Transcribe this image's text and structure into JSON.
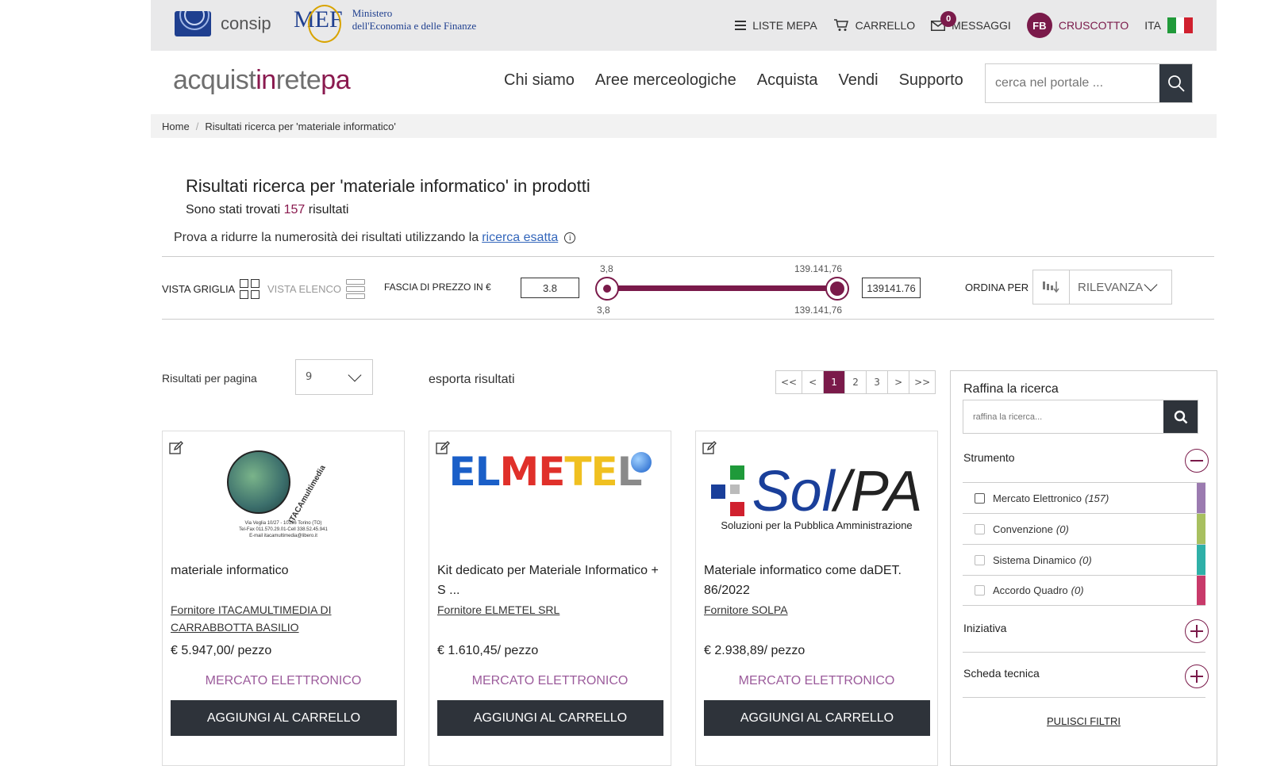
{
  "topbar": {
    "consip": "consip",
    "mef_mark": "MEF",
    "mef_line1": "Ministero",
    "mef_line2": "dell'Economia e delle Finanze",
    "liste": "LISTE MEPA",
    "carrello": "CARRELLO",
    "messaggi": "MESSAGGI",
    "messaggi_count": "0",
    "avatar": "FB",
    "cruscotto": "CRUSCOTTO",
    "lang": "ITA",
    "flag_colors": [
      "#219a3a",
      "#ffffff",
      "#d0202e"
    ]
  },
  "header": {
    "brand_a": "acquist",
    "brand_b": "in",
    "brand_c": "rete",
    "brand_d": "pa",
    "nav": [
      "Chi siamo",
      "Aree merceologiche",
      "Acquista",
      "Vendi",
      "Supporto"
    ],
    "search_placeholder": "cerca nel portale ..."
  },
  "breadcrumb": {
    "home": "Home",
    "sep": "/",
    "current": "Risultati ricerca per 'materiale informatico'"
  },
  "results": {
    "title": "Risultati ricerca per 'materiale informatico' in prodotti",
    "count_prefix": "Sono stati trovati",
    "count": "157",
    "count_suffix": "risultati",
    "hint": "Prova a ridurre la numerosità dei risultati utilizzando la",
    "hint_link": "ricerca esatta",
    "info": "i"
  },
  "filters": {
    "vista_griglia": "VISTA GRIGLIA",
    "vista_elenco": "VISTA ELENCO",
    "fascia_label": "FASCIA DI PREZZO IN €",
    "price_min": "3.8",
    "price_max": "139141.76",
    "slider_min_top": "3,8",
    "slider_max_top": "139.141,76",
    "slider_min_bottom": "3,8",
    "slider_max_bottom": "139.141,76",
    "ordina_label": "ORDINA PER",
    "ordina_value": "RILEVANZA"
  },
  "listing": {
    "rpp_label": "Risultati per pagina",
    "rpp_value": "9",
    "export": "esporta risultati",
    "pager": [
      "<<",
      "<",
      "1",
      "2",
      "3",
      ">",
      ">>"
    ],
    "active_page": "1"
  },
  "cards": [
    {
      "title": "materiale informatico",
      "supplier": "Fornitore ITACAMULTIMEDIA DI CARRABBOTTA BASILIO",
      "price": "€ 5.947,00/ pezzo",
      "market": "MERCATO ELETTRONICO",
      "button": "AGGIUNGI AL CARRELLO",
      "logo_name": "ITACAmultimedia",
      "logo_line1": "Via Veglia 10/27 - 10136 Torino (TO)",
      "logo_line2": "Tel-Fax 011.570.29.01-Cell 338.52.45.941",
      "logo_line3": "E-mail itacamultimedia@libero.it"
    },
    {
      "title": "Kit dedicato per Materiale Informatico + S ...",
      "supplier": "Fornitore ELMETEL SRL",
      "price": "€ 1.610,45/ pezzo",
      "market": "MERCATO ELETTRONICO",
      "button": "AGGIUNGI AL CARRELLO",
      "logo_letters": [
        "E",
        "L",
        "M",
        "E",
        "T",
        "E",
        "L"
      ],
      "logo_colors": [
        "#1a5fc8",
        "#1a5fc8",
        "#e0302a",
        "#e0302a",
        "#f0c020",
        "#f0c020",
        "#8a8a8a"
      ]
    },
    {
      "title": "Materiale informatico come daDET. 86/2022",
      "supplier": "Fornitore SOLPA",
      "price": "€ 2.938,89/ pezzo",
      "market": "MERCATO ELETTRONICO",
      "button": "AGGIUNGI AL CARRELLO",
      "logo_a": "Sol",
      "logo_b": "PA",
      "logo_sub": "Soluzioni per la Pubblica Amministrazione"
    }
  ],
  "sidebar": {
    "heading": "Raffina la ricerca",
    "search_placeholder": "raffina la ricerca...",
    "strumento": "Strumento",
    "facets": [
      {
        "label": "Mercato Elettronico",
        "count": "(157)",
        "color": "#9b7bb0"
      },
      {
        "label": "Convenzione",
        "count": "(0)",
        "color": "#a8c060"
      },
      {
        "label": "Sistema Dinamico",
        "count": "(0)",
        "color": "#2fb0a8"
      },
      {
        "label": "Accordo Quadro",
        "count": "(0)",
        "color": "#c83a6a"
      }
    ],
    "iniziativa": "Iniziativa",
    "scheda": "Scheda tecnica",
    "pulisci": "PULISCI FILTRI"
  }
}
